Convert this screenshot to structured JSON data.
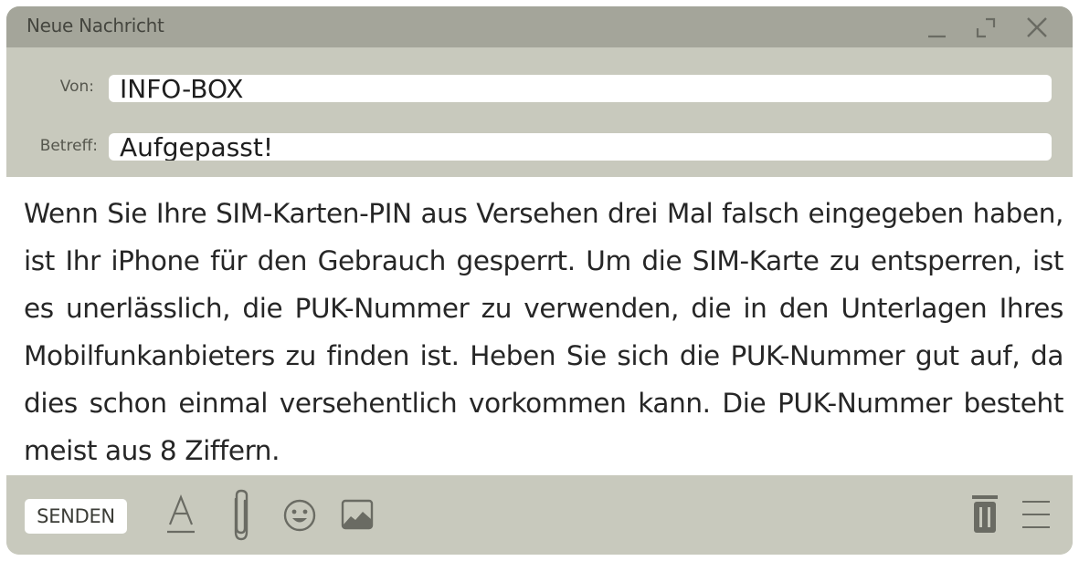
{
  "window": {
    "title": "Neue Nachricht"
  },
  "header": {
    "from_label": "Von:",
    "from_value": "INFO-BOX",
    "subject_label": "Betreff:",
    "subject_value": "Aufgepasst!"
  },
  "message": {
    "body": "Wenn Sie Ihre SIM-Karten-PIN aus Versehen drei Mal falsch eingegeben haben, ist Ihr iPhone für den Gebrauch gesperrt. Um die SIM-Karte zu entsperren, ist es unerlässlich, die PUK-Nummer zu verwenden, die in den Unterlagen Ihres Mobilfunkanbieters zu finden ist. Heben Sie sich die PUK-Nummer gut auf, da dies schon einmal versehentlich vorkommen kann. Die PUK-Nummer besteht meist aus 8 Ziffern."
  },
  "toolbar": {
    "send_label": "SENDEN",
    "icons": [
      "text-format-icon",
      "paperclip-icon",
      "emoji-icon",
      "image-icon",
      "trash-icon",
      "menu-icon"
    ]
  },
  "colors": {
    "titlebar": "#a4a59a",
    "panel": "#c8c9bd",
    "icon": "#6a6b63",
    "text": "#262626"
  }
}
